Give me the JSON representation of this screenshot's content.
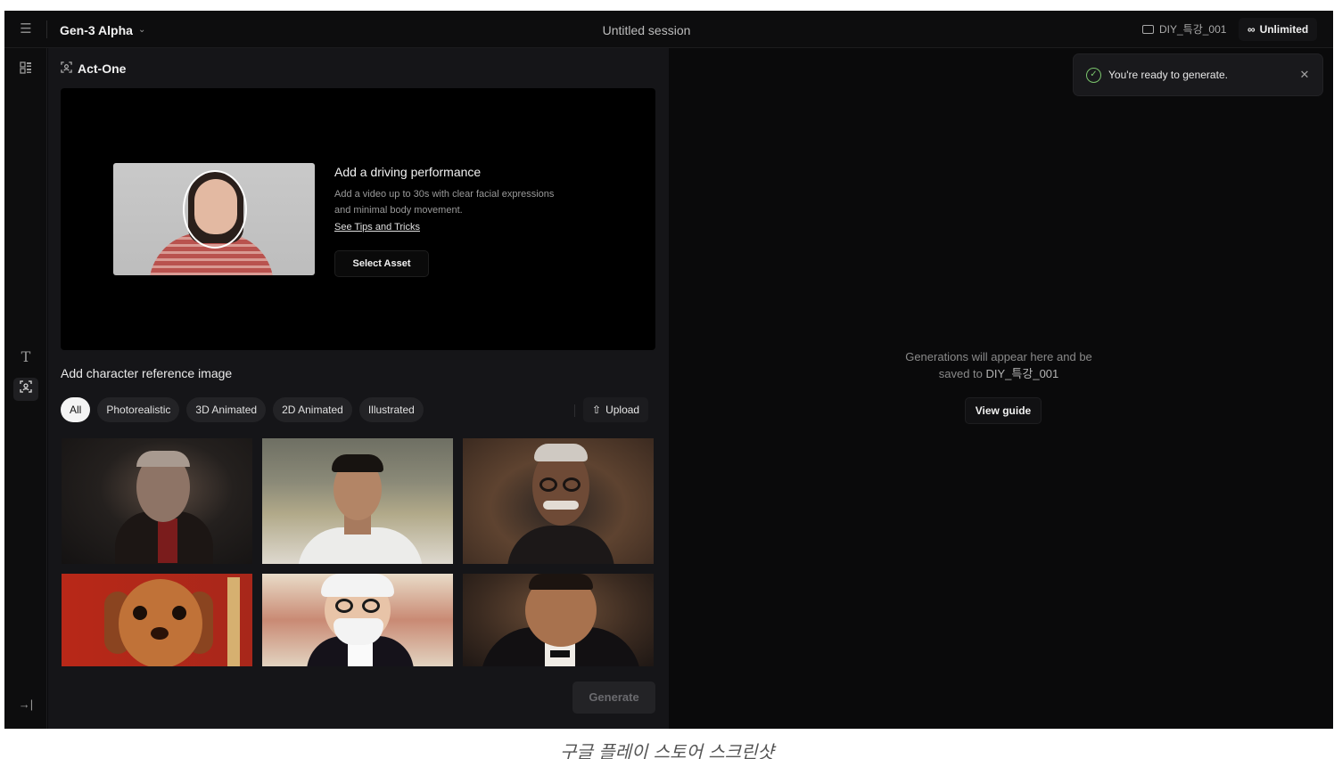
{
  "topbar": {
    "menu_icon": "hamburger-icon",
    "model": "Gen-3 Alpha",
    "session_title": "Untitled session",
    "folder": "DIY_특강_001",
    "plan": "Unlimited",
    "plan_icon": "infinity-icon"
  },
  "rail": {
    "items": [
      "assets-icon",
      "text-icon",
      "act-one-icon"
    ],
    "collapse_icon": "expand-icon"
  },
  "panel": {
    "title": "Act-One",
    "driving": {
      "heading": "Add a driving performance",
      "description": "Add a video up to 30s with clear facial expressions and minimal body movement.",
      "link": "See Tips and Tricks",
      "button": "Select Asset"
    },
    "character_label": "Add character reference image",
    "filters": [
      "All",
      "Photorealistic",
      "3D Animated",
      "2D Animated",
      "Illustrated"
    ],
    "active_filter": "All",
    "upload": "Upload",
    "generate": "Generate"
  },
  "right": {
    "empty_line1": "Generations will appear here and be",
    "empty_line2_prefix": "saved to",
    "empty_folder": "DIY_특강_001",
    "view_guide": "View guide",
    "toast": "You're ready to generate."
  },
  "caption": "구글 플레이 스토어 스크린샷"
}
